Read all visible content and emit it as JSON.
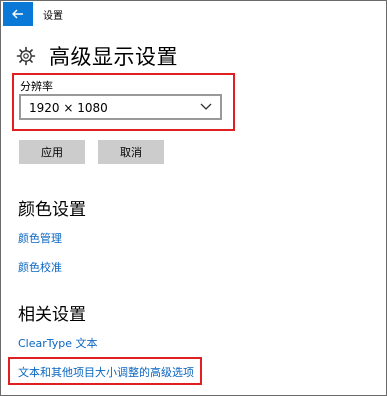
{
  "window": {
    "title": "设置"
  },
  "page": {
    "title": "高级显示设置"
  },
  "resolution": {
    "label": "分辨率",
    "selected": "1920 × 1080"
  },
  "buttons": {
    "apply": "应用",
    "cancel": "取消"
  },
  "color_section": {
    "title": "颜色设置",
    "links": [
      "颜色管理",
      "颜色校准"
    ]
  },
  "related_section": {
    "title": "相关设置",
    "links": [
      "ClearType 文本",
      "文本和其他项目大小调整的高级选项"
    ]
  },
  "colors": {
    "accent": "#0a78d7",
    "link": "#0a66c2",
    "highlight": "#e02020",
    "button": "#cccccc"
  },
  "icons": {
    "back": "back-arrow-icon",
    "settings": "gear-icon",
    "dropdown": "chevron-down-icon"
  }
}
